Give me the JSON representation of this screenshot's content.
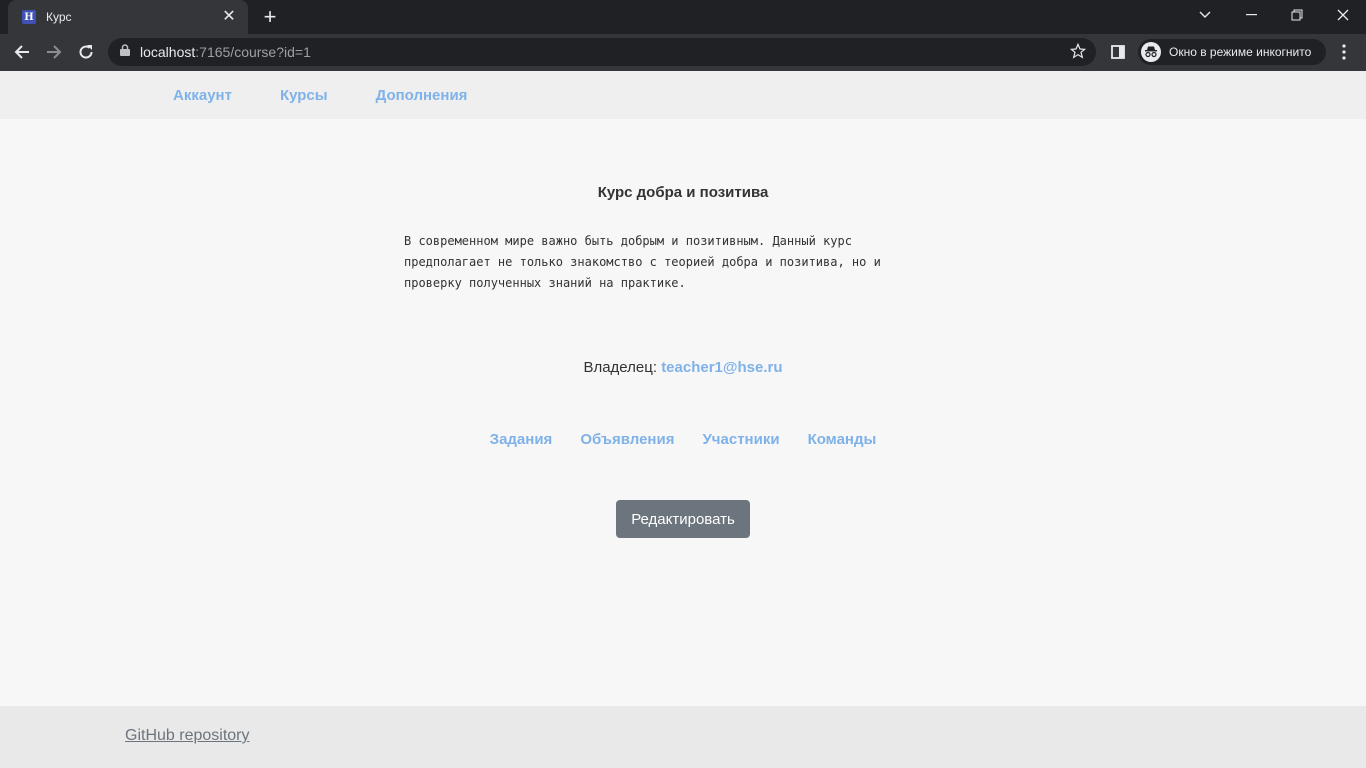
{
  "browser": {
    "tab_title": "Курс",
    "favicon_letter": "H",
    "url_host": "localhost",
    "url_rest": ":7165/course?id=1",
    "incognito_label": "Окно в режиме инкогнито"
  },
  "nav": {
    "items": [
      {
        "label": "Аккаунт"
      },
      {
        "label": "Курсы"
      },
      {
        "label": "Дополнения"
      }
    ]
  },
  "course": {
    "title": "Курс добра и позитива",
    "description_lines": [
      "В современном мире важно быть добрым и позитивным. Данный курс",
      "предполагает не только знакомство с теорией добра и позитива, но и",
      "проверку полученных знаний на практике."
    ],
    "owner_label": "Владелец:",
    "owner_email": "teacher1@hse.ru",
    "menu": [
      {
        "label": "Задания"
      },
      {
        "label": "Объявления"
      },
      {
        "label": "Участники"
      },
      {
        "label": "Команды"
      }
    ],
    "edit_label": "Редактировать"
  },
  "footer": {
    "link_label": "GitHub repository"
  },
  "colors": {
    "link": "#7fb2e9",
    "button": "#6c757d",
    "page_bg": "#f7f7f7",
    "header_bg": "#efefef",
    "footer_bg": "#e9e9e9"
  }
}
